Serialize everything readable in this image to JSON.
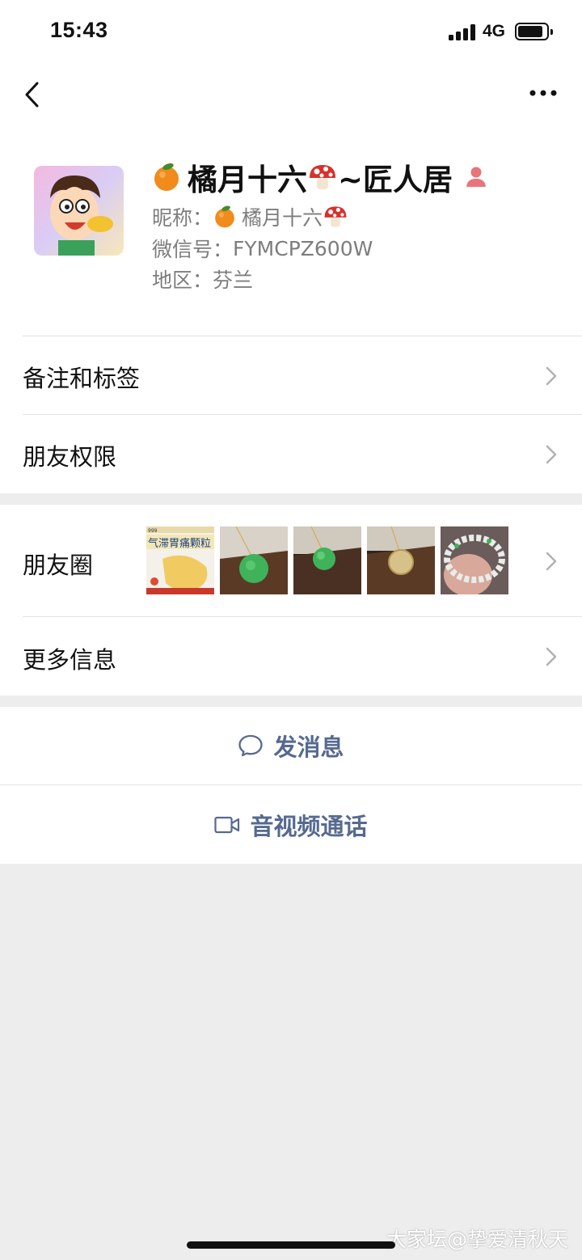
{
  "status_bar": {
    "time": "15:43",
    "network": "4G"
  },
  "profile": {
    "display_name": "橘月十六",
    "display_name_suffix": "~匠人居",
    "nickname_label": "昵称：",
    "nickname": "橘月十六",
    "wechat_id_label": "微信号：",
    "wechat_id": "FYMCPZ600W",
    "region_label": "地区：",
    "region": "芬兰"
  },
  "rows": {
    "remarks_tags": "备注和标签",
    "friend_permissions": "朋友权限",
    "moments": "朋友圈",
    "more_info": "更多信息"
  },
  "moments_thumbs": [
    {
      "name": "medicine-box-thumb",
      "caption": "气滞胃痛颗粒",
      "brand": "999"
    },
    {
      "name": "jade-pendant-thumb-1"
    },
    {
      "name": "jade-pendant-thumb-2"
    },
    {
      "name": "gold-pendant-thumb"
    },
    {
      "name": "bead-bracelet-thumb"
    }
  ],
  "actions": {
    "send_message": "发消息",
    "voice_video_call": "音视频通话"
  },
  "watermark": "大家坛@挚爱清秋天",
  "colors": {
    "link": "#566a90",
    "background": "#ededed",
    "gender_icon": "#e8757a"
  }
}
